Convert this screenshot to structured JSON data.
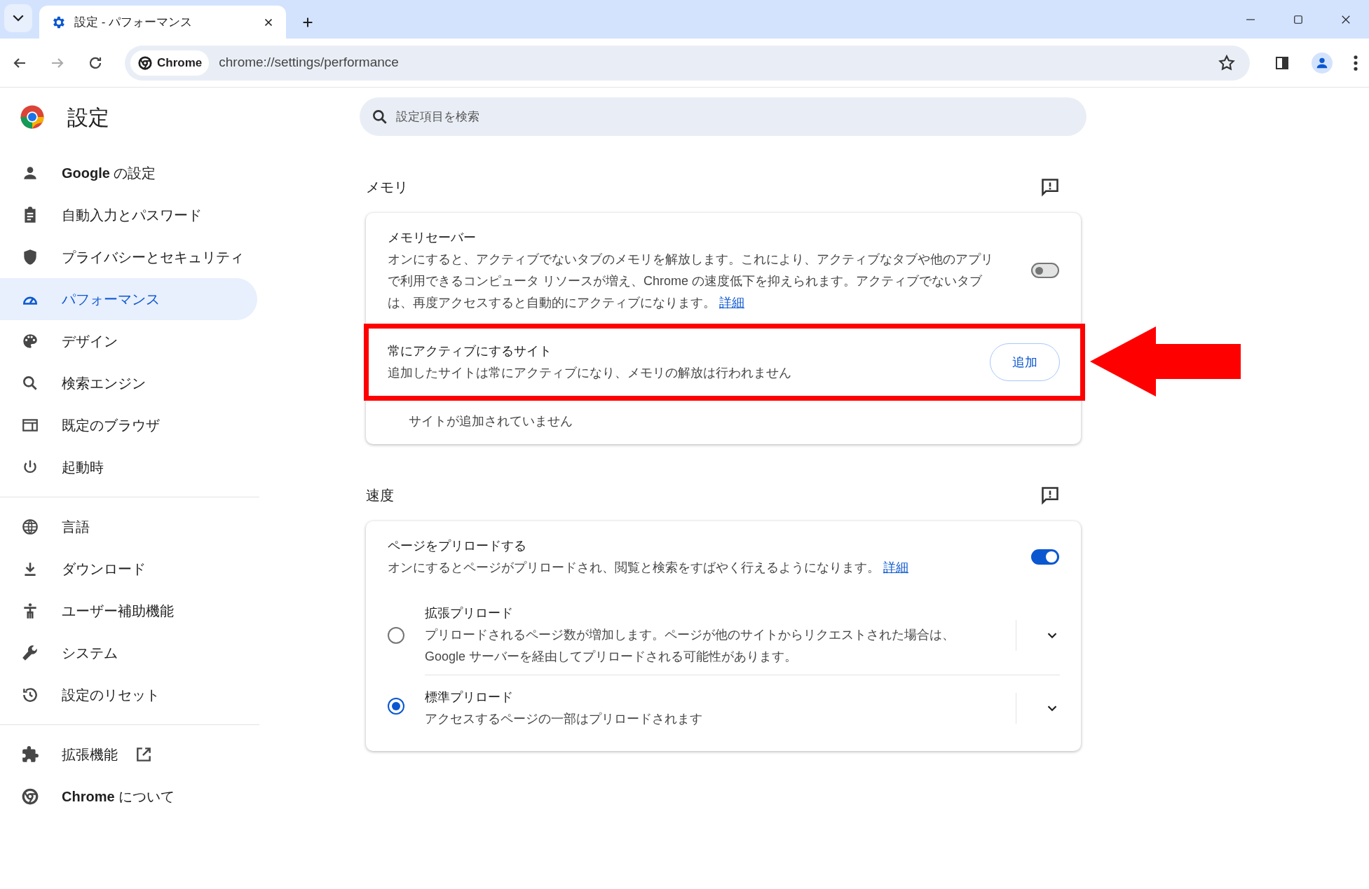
{
  "browser": {
    "tab_title": "設定 - パフォーマンス",
    "chip": "Chrome",
    "url": "chrome://settings/performance"
  },
  "sidebar": {
    "title": "設定",
    "groups": [
      [
        {
          "label": "**Google** の設定",
          "selected": false
        },
        {
          "label": "自動入力とパスワード",
          "selected": false
        },
        {
          "label": "プライバシーとセキュリティ",
          "selected": false
        },
        {
          "label": "パフォーマンス",
          "selected": true
        },
        {
          "label": "デザイン",
          "selected": false
        },
        {
          "label": "検索エンジン",
          "selected": false
        },
        {
          "label": "既定のブラウザ",
          "selected": false
        },
        {
          "label": "起動時",
          "selected": false
        }
      ],
      [
        {
          "label": "言語",
          "selected": false
        },
        {
          "label": "ダウンロード",
          "selected": false
        },
        {
          "label": "ユーザー補助機能",
          "selected": false
        },
        {
          "label": "システム",
          "selected": false
        },
        {
          "label": "設定のリセット",
          "selected": false
        }
      ],
      [
        {
          "label": "拡張機能",
          "selected": false,
          "external": true
        },
        {
          "label": "**Chrome** について",
          "selected": false
        }
      ]
    ]
  },
  "search": {
    "placeholder": "設定項目を検索"
  },
  "memory": {
    "title": "メモリ",
    "setting": {
      "title": "メモリセーバー",
      "description": "オンにすると、アクティブでないタブのメモリを解放します。これにより、アクティブなタブや他のアプリで利用できるコンピュータ リソースが増え、Chrome の速度低下を抑えられます。アクティブでないタブは、再度アクセスすると自動的にアクティブになります。",
      "link": "詳細",
      "on": false
    },
    "always_active": {
      "title": "常にアクティブにするサイト",
      "description": "追加したサイトは常にアクティブになり、メモリの解放は行われません",
      "button": "追加"
    },
    "empty": "サイトが追加されていません"
  },
  "speed": {
    "title": "速度",
    "setting": {
      "title": "ページをプリロードする",
      "description": "オンにするとページがプリロードされ、閲覧と検索をすばやく行えるようになります。",
      "link": "詳細",
      "on": true
    },
    "options": [
      {
        "title": "拡張プリロード",
        "description": "プリロードされるページ数が増加します。ページが他のサイトからリクエストされた場合は、Google サーバーを経由してプリロードされる可能性があります。",
        "selected": false
      },
      {
        "title": "標準プリロード",
        "description": "アクセスするページの一部はプリロードされます",
        "selected": true
      }
    ]
  }
}
